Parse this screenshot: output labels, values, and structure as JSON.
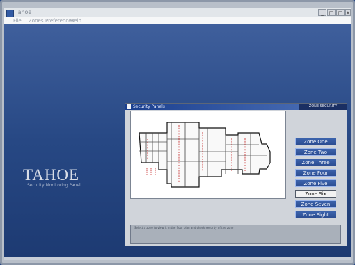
{
  "window": {
    "title": "Tahoe",
    "controls": {
      "minimize": "_",
      "maximize": "□",
      "restore": "□",
      "close": "X"
    }
  },
  "menu": [
    "File",
    "Zones",
    "Preferences",
    "Help"
  ],
  "branding": {
    "title": "TAHOE",
    "subtitle": "Security Monitoring Panel"
  },
  "subwindow": {
    "title": "Security Panels",
    "badge": "ZONE SECURITY"
  },
  "zones": [
    {
      "label": "Zone One"
    },
    {
      "label": "Zone Two"
    },
    {
      "label": "Zone Three"
    },
    {
      "label": "Zone Four"
    },
    {
      "label": "Zone Five"
    },
    {
      "label": "Zone Six"
    },
    {
      "label": "Zone Seven"
    },
    {
      "label": "Zone Eight"
    }
  ],
  "status": {
    "message": "Select a zone to view it in the floor plan and check security of the zone"
  }
}
